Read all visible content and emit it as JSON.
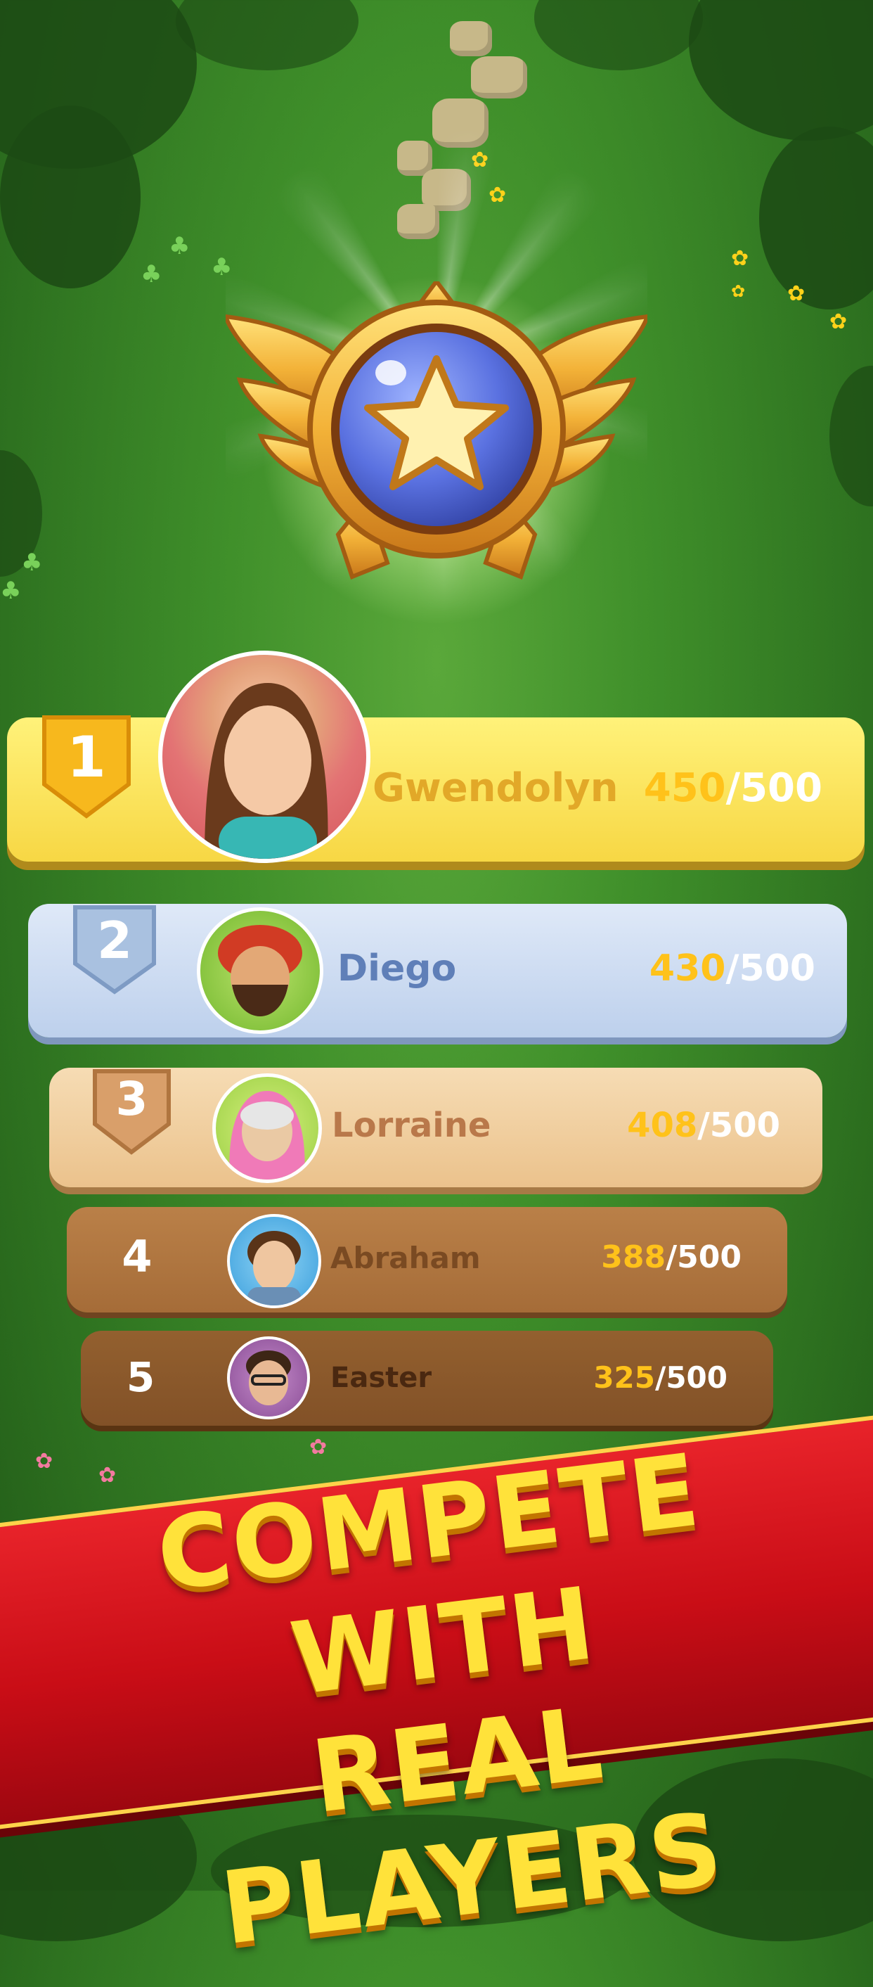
{
  "leaderboard": [
    {
      "rank": "1",
      "name": "Gwendolyn",
      "score": "450",
      "max": "/500"
    },
    {
      "rank": "2",
      "name": "Diego",
      "score": "430",
      "max": "/500"
    },
    {
      "rank": "3",
      "name": "Lorraine",
      "score": "408",
      "max": "/500"
    },
    {
      "rank": "4",
      "name": "Abraham",
      "score": "388",
      "max": "/500"
    },
    {
      "rank": "5",
      "name": "Easter",
      "score": "325",
      "max": "/500"
    }
  ],
  "banner": {
    "line1": "COMPETE WITH",
    "line2": "REAL PLAYERS"
  },
  "colors": {
    "gold_row": "#fce45a",
    "silver_row": "#c9daf0",
    "bronze_row": "#f1cd9c",
    "brown_row_4": "#b07640",
    "brown_row_5": "#8e5a2e",
    "score_accent": "#ffc21a",
    "banner_red": "#d8141c",
    "banner_text": "#ffe23a"
  }
}
